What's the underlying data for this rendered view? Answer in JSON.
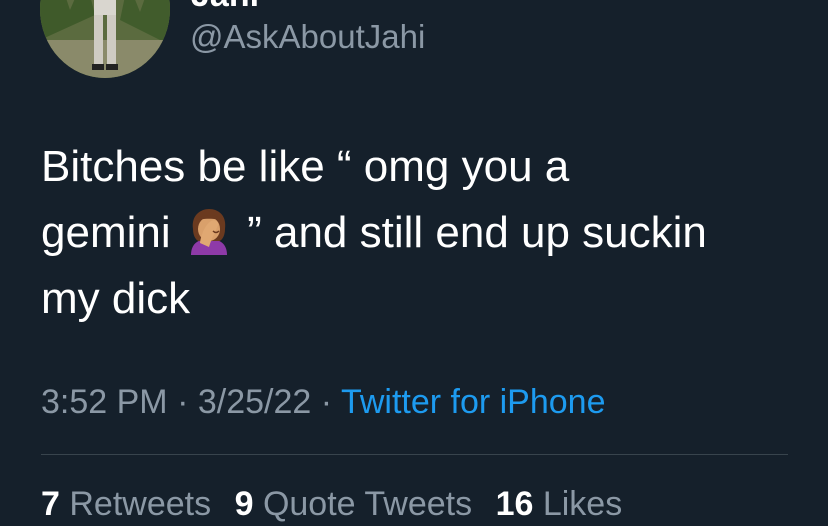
{
  "user": {
    "display_name": "Jahi",
    "handle": "@AskAboutJahi"
  },
  "tweet": {
    "text_line_1": "Bitches be like “ omg you a",
    "text_line_2_before_emoji": "gemini",
    "emoji": "woman-facepalming-icon",
    "text_line_2_after_emoji": "” and still end up suckin",
    "text_line_3": "my dick"
  },
  "meta": {
    "time": "3:52 PM",
    "separator": "·",
    "date": "3/25/22",
    "source": "Twitter for iPhone"
  },
  "stats": {
    "retweets_count": "7",
    "retweets_label": "Retweets",
    "quotes_count": "9",
    "quotes_label": "Quote Tweets",
    "likes_count": "16",
    "likes_label": "Likes"
  },
  "colors": {
    "background": "#15202b",
    "text_primary": "#ffffff",
    "text_secondary": "#8b98a5",
    "link": "#1d9bf0",
    "divider": "#38444d"
  }
}
